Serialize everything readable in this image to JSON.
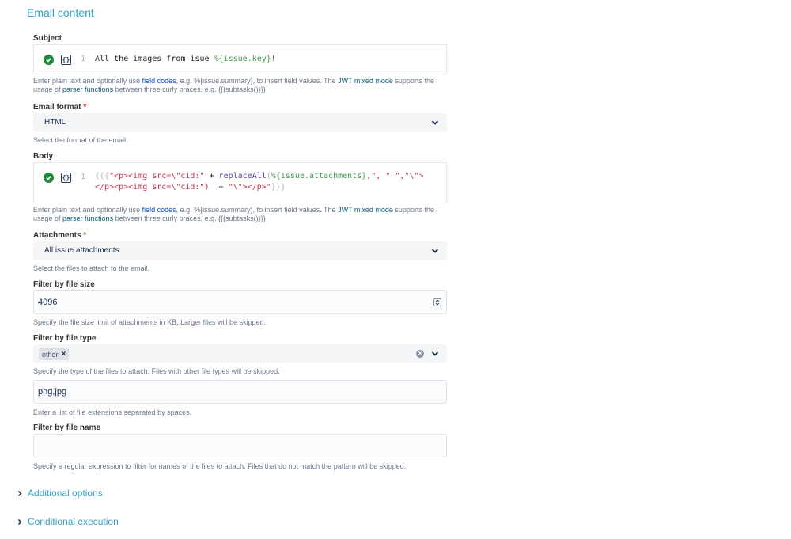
{
  "section_title": "Email content",
  "subject": {
    "label": "Subject",
    "line_number": "1",
    "code_parts": {
      "text": "All the images from isue ",
      "field": "%{issue.key}",
      "end": "!"
    },
    "help": {
      "pre": "Enter plain text and optionally use ",
      "link1": "field codes",
      "mid": ", e.g. %{issue.summary}, to insert field values. The ",
      "link2": "JWT mixed mode",
      "post": " supports the usage of ",
      "link3": "parser functions",
      "tail": " between three curly braces, e.g. {{{subtasks()}}}"
    }
  },
  "email_format": {
    "label": "Email format",
    "required": "*",
    "value": "HTML",
    "help": "Select the format of the email."
  },
  "body": {
    "label": "Body",
    "line_number": "1",
    "code_line1": {
      "a": "{{{",
      "b": "\"<p><img src=\\\"cid:\"",
      "c": " + ",
      "d": "replaceAll",
      "e": "(",
      "f": "%{issue.attachments}",
      "g": ",\", \" ",
      "h": "\",\"\\\">"
    },
    "code_line2": {
      "a": "</p><p><img src=\\\"cid:\")",
      "b": "  + ",
      "c": "\"\\\"></p>\"",
      "d": "}}}"
    },
    "help": {
      "pre": "Enter plain text and optionally use ",
      "link1": "field codes",
      "mid": ", e.g. %{issue.summary}, to insert field values. The ",
      "link2": "JWT mixed mode",
      "post": " supports the usage of ",
      "link3": "parser functions",
      "tail": " between three curly braces, e.g. {{{subtasks()}}}"
    }
  },
  "attachments": {
    "label": "Attachments",
    "required": "*",
    "value": "All issue attachments",
    "help": "Select the files to attach to the email."
  },
  "filter_size": {
    "label": "Filter by file size",
    "value": "4096",
    "help": "Specify the file size limit of attachments in KB. Larger files will be skipped."
  },
  "filter_type": {
    "label": "Filter by file type",
    "tag": "other",
    "help": "Specify the type of the files to attach. Files with other file types will be skipped.",
    "extensions_value": "png,jpg",
    "extensions_help": "Enter a list of file extensions separated by spaces."
  },
  "filter_name": {
    "label": "Filter by file name",
    "value": "",
    "help": "Specify a regular expression to filter for names of the files to attach. Files that do not match the pattern will be skipped."
  },
  "collapsibles": [
    "Additional options",
    "Conditional execution"
  ]
}
